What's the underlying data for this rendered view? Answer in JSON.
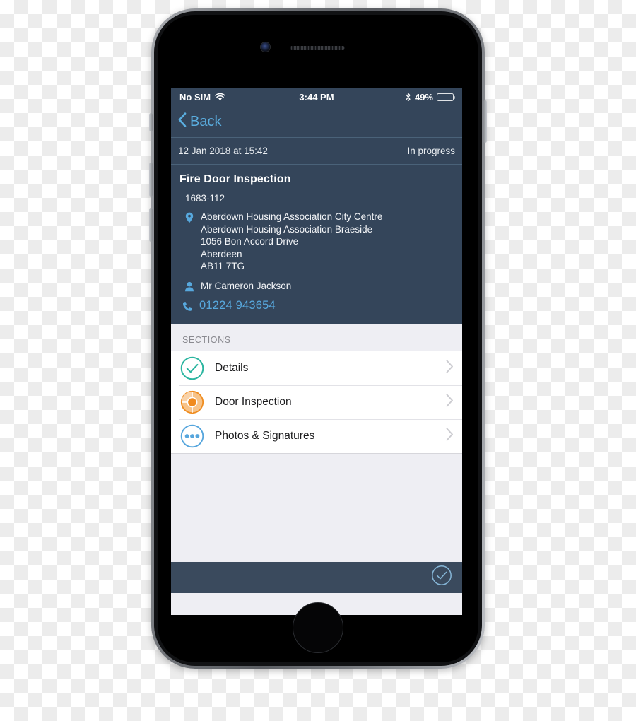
{
  "device": {
    "type": "smartphone",
    "hardware": {
      "front_camera": "camera-icon",
      "earpiece": "speaker-grille",
      "home_button": "home-button",
      "mute_switch": "mute-switch",
      "volume_up": "volume-up-button",
      "volume_down": "volume-down-button",
      "power": "power-button"
    }
  },
  "status_bar": {
    "carrier": "No SIM",
    "wifi_icon": "wifi-icon",
    "time": "3:44 PM",
    "bluetooth_icon": "bluetooth-icon",
    "battery_percent": "49%",
    "battery_level": 49,
    "battery_icon": "battery-icon"
  },
  "nav_bar": {
    "back_label": "Back",
    "back_icon": "chevron-left-icon"
  },
  "meta_bar": {
    "datetime": "12 Jan 2018 at 15:42",
    "status": "In progress"
  },
  "job": {
    "title": "Fire Door Inspection",
    "reference": "1683-112",
    "location_icon": "map-pin-icon",
    "address": [
      "Aberdown Housing Association City Centre",
      "Aberdown Housing Association Braeside",
      "1056 Bon Accord Drive",
      "Aberdeen",
      "AB11 7TG"
    ],
    "contact_icon": "person-icon",
    "contact_name": "Mr Cameron Jackson",
    "phone_icon": "phone-icon",
    "phone_number": "01224 943654"
  },
  "sections": {
    "header": "SECTIONS",
    "items": [
      {
        "label": "Details",
        "icon": "check-circle-icon",
        "status": "complete",
        "color": "#2bb5a0",
        "chevron": "chevron-right-icon"
      },
      {
        "label": "Door Inspection",
        "icon": "progress-pie-icon",
        "status": "in-progress",
        "color": "#f08a1e",
        "chevron": "chevron-right-icon"
      },
      {
        "label": "Photos & Signatures",
        "icon": "dots-circle-icon",
        "status": "not-started",
        "color": "#56a6dd",
        "chevron": "chevron-right-icon"
      }
    ]
  },
  "toolbar": {
    "complete_icon": "check-circle-icon"
  },
  "colors": {
    "header_bg": "#34455a",
    "toolbar_bg": "#3a4a5d",
    "accent_blue": "#57a8dd",
    "list_bg": "#eeeef3",
    "teal": "#2bb5a0",
    "orange": "#f08a1e",
    "blue": "#56a6dd"
  }
}
